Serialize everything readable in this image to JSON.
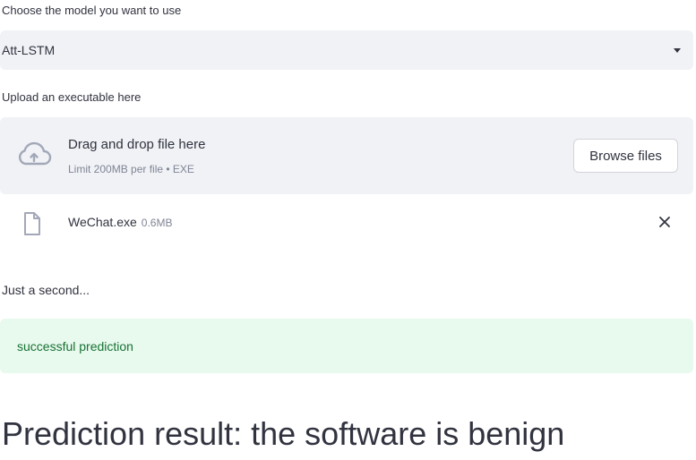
{
  "model_select": {
    "label": "Choose the model you want to use",
    "selected_value": "Att-LSTM"
  },
  "uploader": {
    "label": "Upload an executable here",
    "drop_title": "Drag and drop file here",
    "drop_limit": "Limit 200MB per file • EXE",
    "browse_label": "Browse files",
    "upload_icon": "cloud-upload-icon"
  },
  "uploaded_file": {
    "name": "WeChat.exe",
    "size": "0.6MB",
    "file_icon": "file-icon",
    "remove_icon": "close-icon"
  },
  "status": {
    "text": "Just a second..."
  },
  "alert": {
    "text": "successful prediction",
    "bg_color": "#e8f9ee",
    "text_color": "#177233"
  },
  "result": {
    "heading": "Prediction result: the software is benign"
  }
}
